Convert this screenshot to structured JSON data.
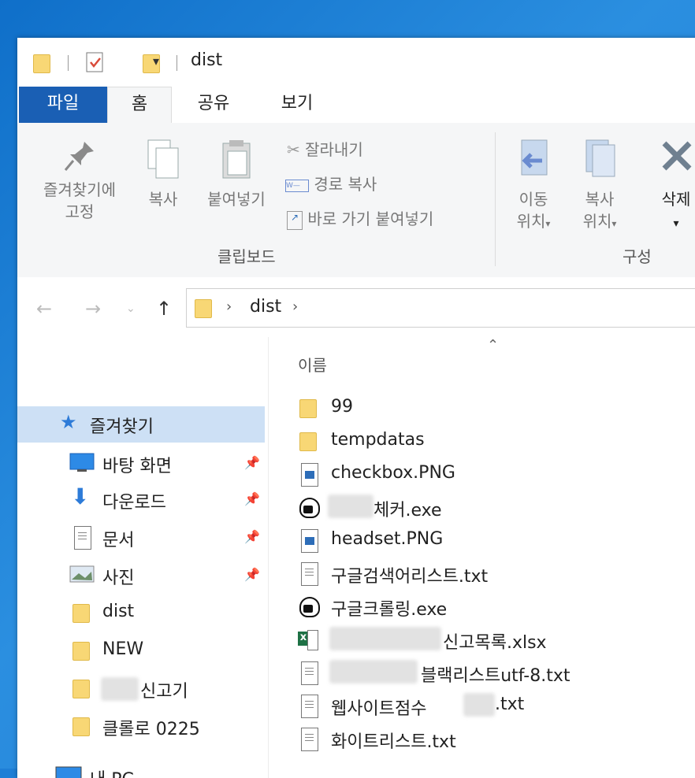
{
  "window": {
    "title": "dist"
  },
  "tabs": [
    {
      "label": "파일"
    },
    {
      "label": "홈"
    },
    {
      "label": "공유"
    },
    {
      "label": "보기"
    }
  ],
  "ribbon": {
    "pin_label_1": "즐겨찾기에",
    "pin_label_2": "고정",
    "copy": "복사",
    "paste": "붙여넣기",
    "cut": "잘라내기",
    "copy_path": "경로 복사",
    "paste_shortcut": "바로 가기 붙여넣기",
    "clipboard_group": "클립보드",
    "move_to_1": "이동",
    "move_to_2": "위치",
    "copy_to_1": "복사",
    "copy_to_2": "위치",
    "delete": "삭제",
    "organize_group": "구성"
  },
  "address": {
    "path": "dist"
  },
  "navpane": {
    "quick_access": "즐겨찾기",
    "items": [
      {
        "label": "바탕 화면"
      },
      {
        "label": "다운로드"
      },
      {
        "label": "문서"
      },
      {
        "label": "사진"
      },
      {
        "label": "dist"
      },
      {
        "label": "NEW"
      },
      {
        "label": "신고기"
      },
      {
        "label": "클롤로 0225"
      }
    ],
    "this_pc": "내 PC"
  },
  "filelist": {
    "column_name": "이름",
    "files": [
      {
        "name": "99",
        "type": "folder"
      },
      {
        "name": "tempdatas",
        "type": "folder"
      },
      {
        "name": "checkbox.PNG",
        "type": "image"
      },
      {
        "name": "체커.exe",
        "type": "exe"
      },
      {
        "name": "headset.PNG",
        "type": "image"
      },
      {
        "name": "구글검색어리스트.txt",
        "type": "text"
      },
      {
        "name": "구글크롤링.exe",
        "type": "exe"
      },
      {
        "name": "신고목록.xlsx",
        "type": "excel"
      },
      {
        "name": "블랙리스트utf-8.txt",
        "type": "text"
      },
      {
        "name": "웹사이트점수",
        "name_suffix": ".txt",
        "type": "text"
      },
      {
        "name": "화이트리스트.txt",
        "type": "text"
      }
    ]
  }
}
